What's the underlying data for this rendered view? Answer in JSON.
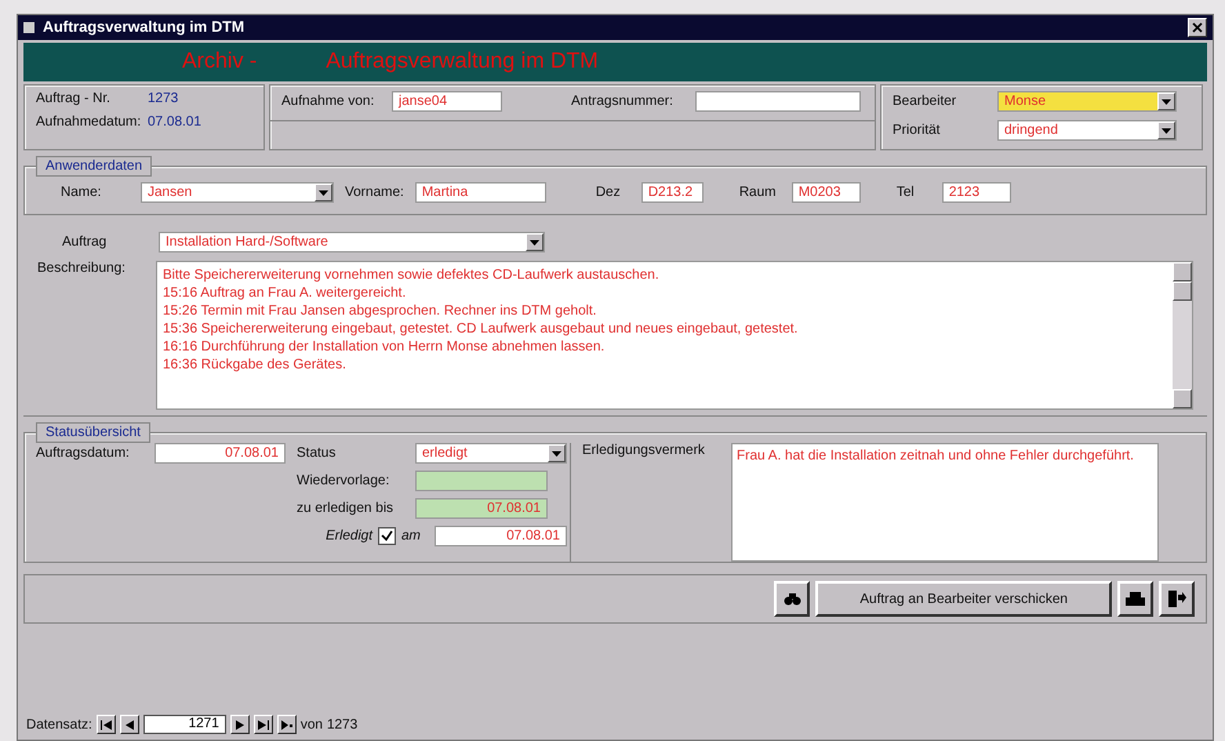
{
  "window": {
    "title": "Auftragsverwaltung im DTM"
  },
  "banner": {
    "prefix": "Archiv -",
    "title": "Auftragsverwaltung im DTM"
  },
  "header": {
    "order_no_label": "Auftrag - Nr.",
    "order_no": "1273",
    "date_label": "Aufnahmedatum:",
    "date": "07.08.01",
    "taken_by_label": "Aufnahme von:",
    "taken_by": "janse04",
    "request_no_label": "Antragsnummer:",
    "editor_label": "Bearbeiter",
    "editor": "Monse",
    "priority_label": "Priorität",
    "priority": "dringend"
  },
  "user_group": {
    "legend": "Anwenderdaten",
    "name_label": "Name:",
    "name": "Jansen",
    "first_name_label": "Vorname:",
    "first_name": "Martina",
    "dez_label": "Dez",
    "dez": "D213.2",
    "room_label": "Raum",
    "room": "M0203",
    "tel_label": "Tel",
    "tel": "2123"
  },
  "order": {
    "label": "Auftrag",
    "value": "Installation Hard-/Software",
    "description_label": "Beschreibung:",
    "description_lines": [
      "Bitte Speichererweiterung vornehmen sowie defektes CD-Laufwerk austauschen.",
      "15:16 Auftrag an Frau A. weitergereicht.",
      "15:26 Termin mit Frau Jansen abgesprochen. Rechner ins DTM geholt.",
      "15:36 Speichererweiterung eingebaut, getestet. CD Laufwerk ausgebaut und neues eingebaut, getestet.",
      "16:16 Durchführung der Installation von Herrn Monse abnehmen lassen.",
      "16:36 Rückgabe des Gerätes."
    ]
  },
  "status_group": {
    "legend": "Statusübersicht",
    "order_date_label": "Auftragsdatum:",
    "order_date": "07.08.01",
    "status_label": "Status",
    "status": "erledigt",
    "resubmit_label": "Wiedervorlage:",
    "due_label": "zu erledigen bis",
    "due": "07.08.01",
    "done_label": "Erledigt",
    "done_checked": true,
    "on_label": "am",
    "done_date": "07.08.01",
    "remark_label": "Erledigungsvermerk",
    "remark": "Frau A. hat die Installation zeitnah und ohne Fehler durchgeführt."
  },
  "actions": {
    "send_button": "Auftrag an Bearbeiter verschicken"
  },
  "navigation": {
    "label": "Datensatz:",
    "record": "1271",
    "of_label": "von",
    "total": "1273"
  }
}
